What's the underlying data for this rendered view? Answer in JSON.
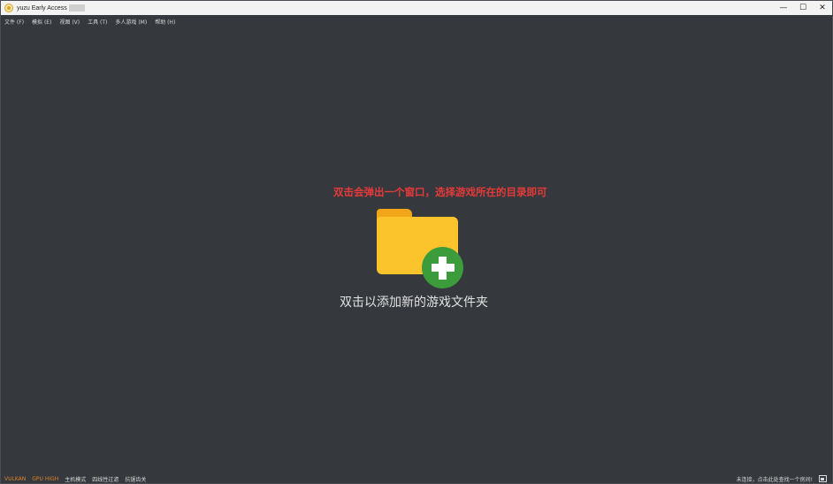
{
  "window": {
    "title": "yuzu Early Access",
    "controls": {
      "minimize": "—",
      "maximize": "☐",
      "close": "✕"
    }
  },
  "menu": {
    "items": [
      {
        "label": "文件 (F)"
      },
      {
        "label": "模拟 (E)"
      },
      {
        "label": "视图 (V)"
      },
      {
        "label": "工具 (T)"
      },
      {
        "label": "多人游戏 (M)"
      },
      {
        "label": "帮助 (H)"
      }
    ]
  },
  "main": {
    "annotation": "双击会弹出一个窗口，选择游戏所在的目录即可",
    "add_folder_label": "双击以添加新的游戏文件夹",
    "icons": {
      "folder": "folder-icon",
      "plus": "plus-circle-icon"
    }
  },
  "statusbar": {
    "items": [
      {
        "label": "VULKAN",
        "color": "#e0832a"
      },
      {
        "label": "GPU HIGH",
        "color": "#e0832a"
      },
      {
        "label": "主机模式",
        "color": "#d9d9d9"
      },
      {
        "label": "四线性过滤",
        "color": "#d9d9d9"
      },
      {
        "label": "抗锯齿关",
        "color": "#d9d9d9"
      }
    ],
    "right_text": "未连接，点击此处查找一个房间!",
    "right_icon": "network-room-icon"
  },
  "colors": {
    "background": "#35383c",
    "annotation": "#e53a3a",
    "folder": "#fbc42c",
    "plus": "#3c9b3b"
  }
}
